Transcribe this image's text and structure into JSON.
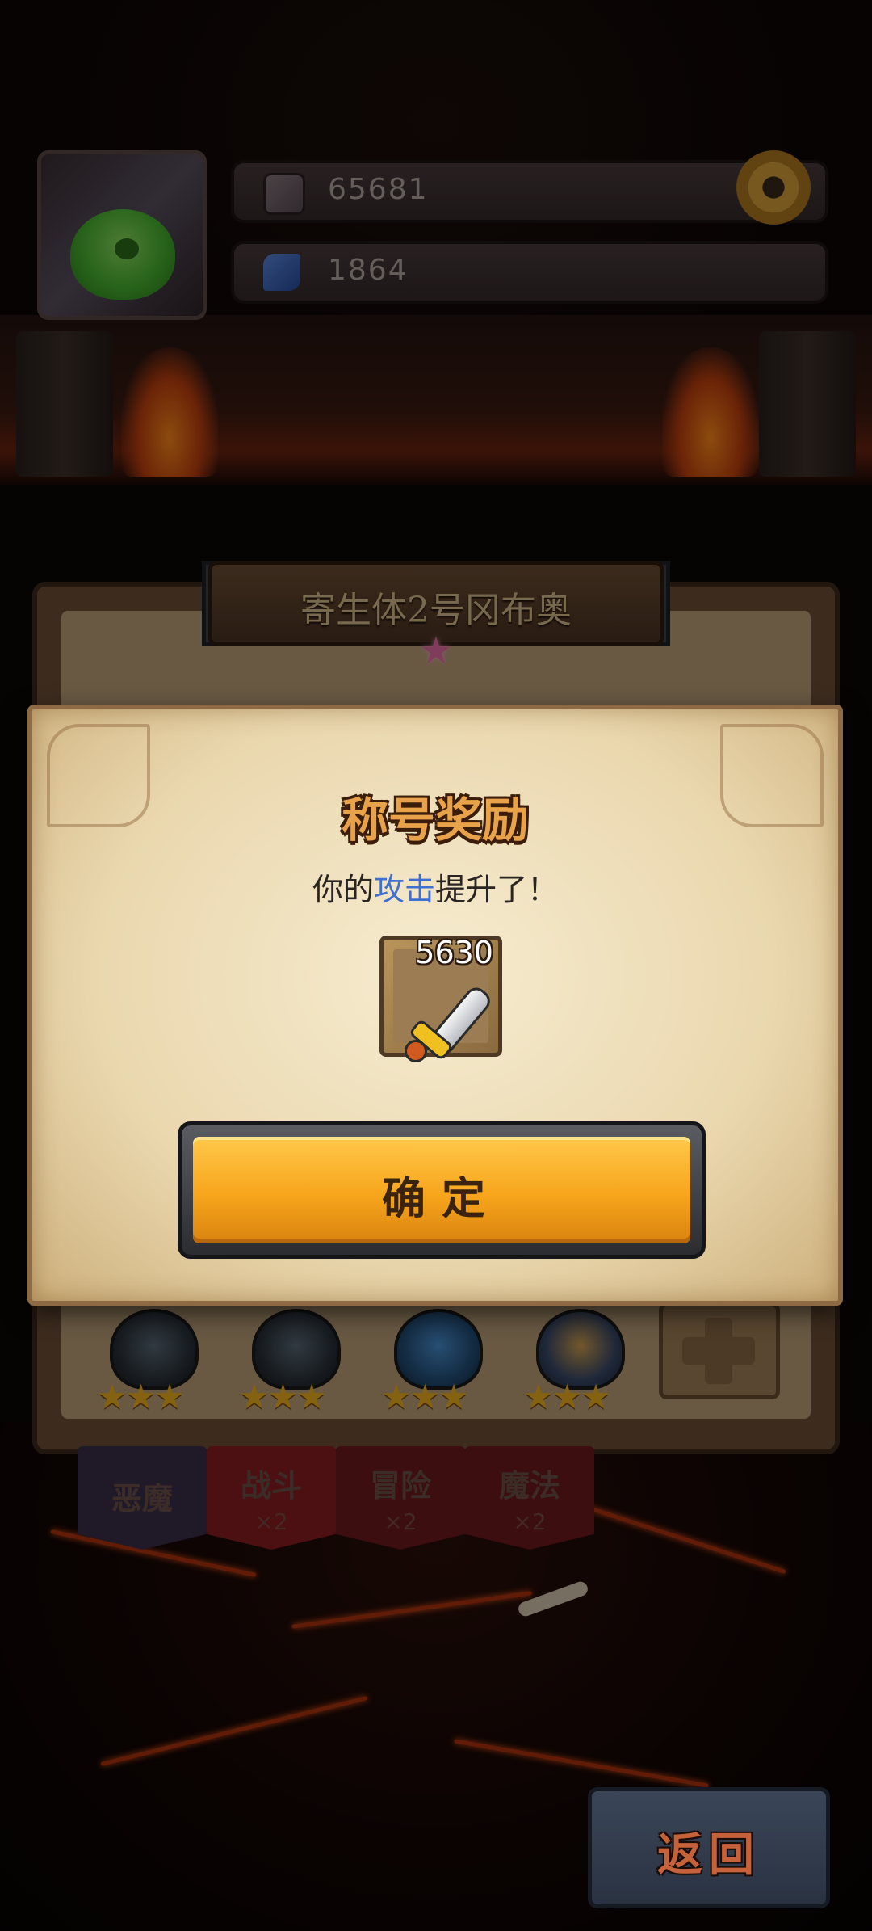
{
  "hud": {
    "gold_value": "65681",
    "gem_value": "1864",
    "gold_icon": "coin-bag-icon",
    "gem_icon": "blue-gem-icon",
    "settings_icon": "gear-icon"
  },
  "monster": {
    "name": "寄生体2号冈布奥"
  },
  "tabs": [
    {
      "label": "恶魔",
      "mult": ""
    },
    {
      "label": "战斗",
      "mult": "×2"
    },
    {
      "label": "冒险",
      "mult": "×2"
    },
    {
      "label": "魔法",
      "mult": "×2"
    }
  ],
  "class_slots": [
    {
      "stars": 3
    },
    {
      "stars": 3
    },
    {
      "stars": 3
    },
    {
      "stars": 3
    }
  ],
  "dialog": {
    "title": "称号奖励",
    "message_prefix": "你的",
    "message_highlight": "攻击",
    "message_suffix": "提升了！",
    "reward_value": "5630",
    "reward_icon": "sword-icon",
    "confirm_label": "确定"
  },
  "back_button": {
    "label": "返回"
  },
  "colors": {
    "highlight": "#3f6fd0",
    "title": "#e7a24a",
    "confirm": "#f7a51c"
  }
}
